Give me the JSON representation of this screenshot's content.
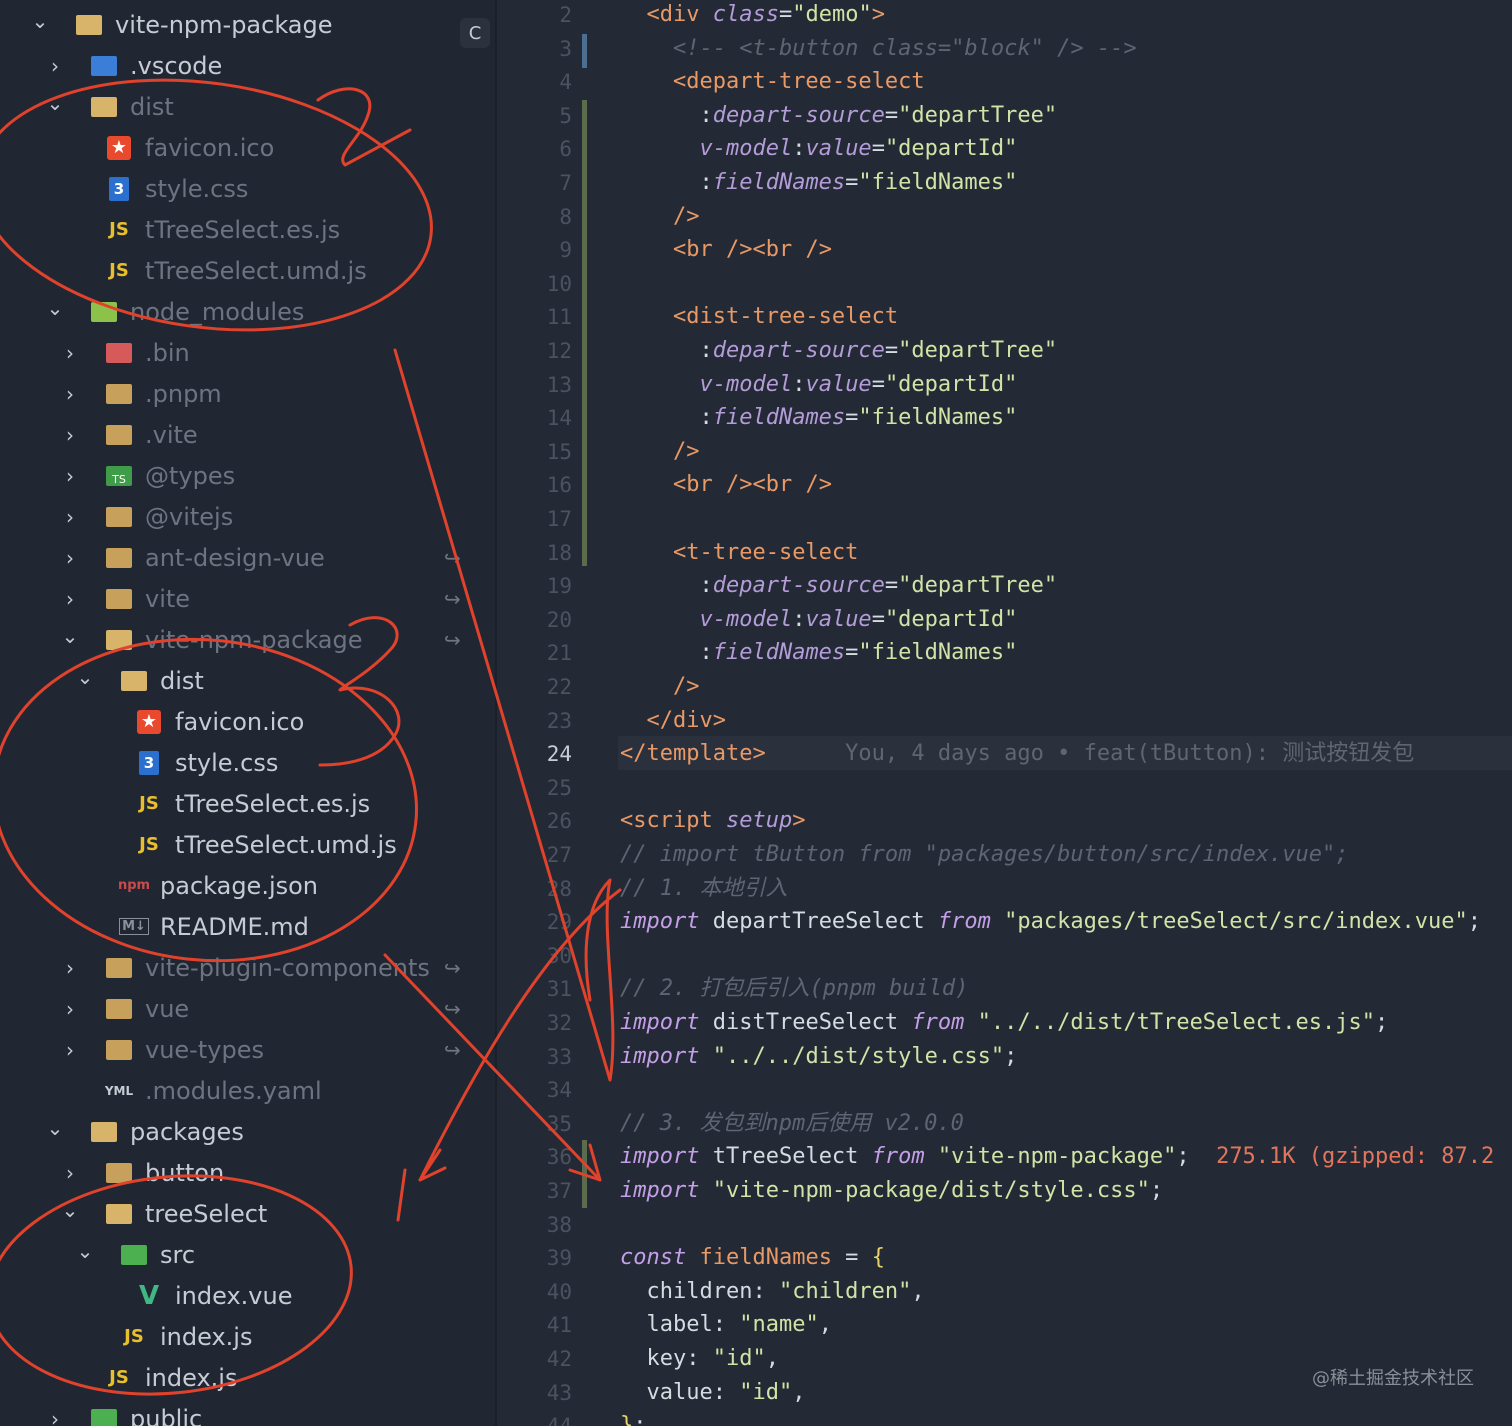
{
  "explorer": {
    "git_status_badge": "C",
    "tree": [
      {
        "label": "vite-npm-package",
        "indent": 0,
        "chevron": "down",
        "icon": "folder-open-icon",
        "style": "bright"
      },
      {
        "label": ".vscode",
        "indent": 1,
        "chevron": "right",
        "icon": "vscode-folder-icon",
        "style": "bright"
      },
      {
        "label": "dist",
        "indent": 1,
        "chevron": "down",
        "icon": "folder-open-icon",
        "style": "dim"
      },
      {
        "label": "favicon.ico",
        "indent": 2,
        "chevron": "",
        "icon": "favicon-icon",
        "style": "dim"
      },
      {
        "label": "style.css",
        "indent": 2,
        "chevron": "",
        "icon": "css-icon",
        "style": "dim"
      },
      {
        "label": "tTreeSelect.es.js",
        "indent": 2,
        "chevron": "",
        "icon": "js-icon",
        "style": "dim"
      },
      {
        "label": "tTreeSelect.umd.js",
        "indent": 2,
        "chevron": "",
        "icon": "js-icon",
        "style": "dim"
      },
      {
        "label": "node_modules",
        "indent": 1,
        "chevron": "down",
        "icon": "node-folder-icon",
        "style": "dim"
      },
      {
        "label": ".bin",
        "indent": 2,
        "chevron": "right",
        "icon": "bin-folder-icon",
        "style": "dim"
      },
      {
        "label": ".pnpm",
        "indent": 2,
        "chevron": "right",
        "icon": "folder-icon",
        "style": "dim"
      },
      {
        "label": ".vite",
        "indent": 2,
        "chevron": "right",
        "icon": "folder-icon",
        "style": "dim"
      },
      {
        "label": "@types",
        "indent": 2,
        "chevron": "right",
        "icon": "ts-folder-icon",
        "style": "dim"
      },
      {
        "label": "@vitejs",
        "indent": 2,
        "chevron": "right",
        "icon": "folder-icon",
        "style": "dim"
      },
      {
        "label": "ant-design-vue",
        "indent": 2,
        "chevron": "right",
        "icon": "folder-icon",
        "style": "dim",
        "git": "↪"
      },
      {
        "label": "vite",
        "indent": 2,
        "chevron": "right",
        "icon": "folder-icon",
        "style": "dim",
        "git": "↪"
      },
      {
        "label": "vite-npm-package",
        "indent": 2,
        "chevron": "down",
        "icon": "folder-open-icon",
        "style": "dim",
        "git": "↪"
      },
      {
        "label": "dist",
        "indent": 3,
        "chevron": "down",
        "icon": "folder-open-icon",
        "style": "bright"
      },
      {
        "label": "favicon.ico",
        "indent": 4,
        "chevron": "",
        "icon": "favicon-icon",
        "style": "bright"
      },
      {
        "label": "style.css",
        "indent": 4,
        "chevron": "",
        "icon": "css-icon",
        "style": "bright"
      },
      {
        "label": "tTreeSelect.es.js",
        "indent": 4,
        "chevron": "",
        "icon": "js-icon",
        "style": "bright"
      },
      {
        "label": "tTreeSelect.umd.js",
        "indent": 4,
        "chevron": "",
        "icon": "js-icon",
        "style": "bright"
      },
      {
        "label": "package.json",
        "indent": 3,
        "chevron": "",
        "icon": "npm-icon",
        "style": "bright"
      },
      {
        "label": "README.md",
        "indent": 3,
        "chevron": "",
        "icon": "markdown-icon",
        "style": "bright"
      },
      {
        "label": "vite-plugin-components",
        "indent": 2,
        "chevron": "right",
        "icon": "folder-icon",
        "style": "dim",
        "git": "↪"
      },
      {
        "label": "vue",
        "indent": 2,
        "chevron": "right",
        "icon": "folder-icon",
        "style": "dim",
        "git": "↪"
      },
      {
        "label": "vue-types",
        "indent": 2,
        "chevron": "right",
        "icon": "folder-icon",
        "style": "dim",
        "git": "↪"
      },
      {
        "label": ".modules.yaml",
        "indent": 2,
        "chevron": "",
        "icon": "yaml-icon",
        "style": "dim"
      },
      {
        "label": "packages",
        "indent": 1,
        "chevron": "down",
        "icon": "folder-open-icon",
        "style": "bright"
      },
      {
        "label": "button",
        "indent": 2,
        "chevron": "right",
        "icon": "folder-icon",
        "style": "bright"
      },
      {
        "label": "treeSelect",
        "indent": 2,
        "chevron": "down",
        "icon": "folder-open-icon",
        "style": "bright"
      },
      {
        "label": "src",
        "indent": 3,
        "chevron": "down",
        "icon": "src-folder-icon",
        "style": "bright"
      },
      {
        "label": "index.vue",
        "indent": 4,
        "chevron": "",
        "icon": "vue-icon",
        "style": "bright"
      },
      {
        "label": "index.js",
        "indent": 3,
        "chevron": "",
        "icon": "js-icon",
        "style": "bright"
      },
      {
        "label": "index.js",
        "indent": 2,
        "chevron": "",
        "icon": "js-icon",
        "style": "bright"
      },
      {
        "label": "public",
        "indent": 1,
        "chevron": "right",
        "icon": "public-folder-icon",
        "style": "bright"
      }
    ]
  },
  "editor": {
    "current_line": 24,
    "lines": [
      {
        "n": 2,
        "tokens": [
          [
            "  ",
            "plain"
          ],
          [
            "<div ",
            "tag"
          ],
          [
            "class",
            "attr"
          ],
          [
            "=",
            "plain"
          ],
          [
            "\"demo\"",
            "str"
          ],
          [
            ">",
            "tag"
          ]
        ]
      },
      {
        "n": 3,
        "tokens": [
          [
            "    <!-- <t-button class=\"block\" /> -->",
            "cmt"
          ]
        ]
      },
      {
        "n": 4,
        "tokens": [
          [
            "    ",
            "plain"
          ],
          [
            "<depart-tree-select",
            "tag"
          ]
        ]
      },
      {
        "n": 5,
        "tokens": [
          [
            "      :",
            "plain"
          ],
          [
            "depart-source",
            "attr"
          ],
          [
            "=",
            "plain"
          ],
          [
            "\"departTree\"",
            "str"
          ]
        ]
      },
      {
        "n": 6,
        "tokens": [
          [
            "      ",
            "plain"
          ],
          [
            "v-model",
            "attr"
          ],
          [
            ":",
            "plain"
          ],
          [
            "value",
            "attr"
          ],
          [
            "=",
            "plain"
          ],
          [
            "\"departId\"",
            "str"
          ]
        ]
      },
      {
        "n": 7,
        "tokens": [
          [
            "      :",
            "plain"
          ],
          [
            "fieldNames",
            "attr"
          ],
          [
            "=",
            "plain"
          ],
          [
            "\"fieldNames\"",
            "str"
          ]
        ]
      },
      {
        "n": 8,
        "tokens": [
          [
            "    ",
            "plain"
          ],
          [
            "/>",
            "tag"
          ]
        ]
      },
      {
        "n": 9,
        "tokens": [
          [
            "    ",
            "plain"
          ],
          [
            "<br />",
            "tag"
          ],
          [
            "<br />",
            "tag"
          ]
        ]
      },
      {
        "n": 10,
        "tokens": []
      },
      {
        "n": 11,
        "tokens": [
          [
            "    ",
            "plain"
          ],
          [
            "<dist-tree-select",
            "tag"
          ]
        ]
      },
      {
        "n": 12,
        "tokens": [
          [
            "      :",
            "plain"
          ],
          [
            "depart-source",
            "attr"
          ],
          [
            "=",
            "plain"
          ],
          [
            "\"departTree\"",
            "str"
          ]
        ]
      },
      {
        "n": 13,
        "tokens": [
          [
            "      ",
            "plain"
          ],
          [
            "v-model",
            "attr"
          ],
          [
            ":",
            "plain"
          ],
          [
            "value",
            "attr"
          ],
          [
            "=",
            "plain"
          ],
          [
            "\"departId\"",
            "str"
          ]
        ]
      },
      {
        "n": 14,
        "tokens": [
          [
            "      :",
            "plain"
          ],
          [
            "fieldNames",
            "attr"
          ],
          [
            "=",
            "plain"
          ],
          [
            "\"fieldNames\"",
            "str"
          ]
        ]
      },
      {
        "n": 15,
        "tokens": [
          [
            "    ",
            "plain"
          ],
          [
            "/>",
            "tag"
          ]
        ]
      },
      {
        "n": 16,
        "tokens": [
          [
            "    ",
            "plain"
          ],
          [
            "<br />",
            "tag"
          ],
          [
            "<br />",
            "tag"
          ]
        ]
      },
      {
        "n": 17,
        "tokens": []
      },
      {
        "n": 18,
        "tokens": [
          [
            "    ",
            "plain"
          ],
          [
            "<t-tree-select",
            "tag"
          ]
        ]
      },
      {
        "n": 19,
        "tokens": [
          [
            "      :",
            "plain"
          ],
          [
            "depart-source",
            "attr"
          ],
          [
            "=",
            "plain"
          ],
          [
            "\"departTree\"",
            "str"
          ]
        ]
      },
      {
        "n": 20,
        "tokens": [
          [
            "      ",
            "plain"
          ],
          [
            "v-model",
            "attr"
          ],
          [
            ":",
            "plain"
          ],
          [
            "value",
            "attr"
          ],
          [
            "=",
            "plain"
          ],
          [
            "\"departId\"",
            "str"
          ]
        ]
      },
      {
        "n": 21,
        "tokens": [
          [
            "      :",
            "plain"
          ],
          [
            "fieldNames",
            "attr"
          ],
          [
            "=",
            "plain"
          ],
          [
            "\"fieldNames\"",
            "str"
          ]
        ]
      },
      {
        "n": 22,
        "tokens": [
          [
            "    ",
            "plain"
          ],
          [
            "/>",
            "tag"
          ]
        ]
      },
      {
        "n": 23,
        "tokens": [
          [
            "  ",
            "plain"
          ],
          [
            "</div>",
            "tag"
          ]
        ]
      },
      {
        "n": 24,
        "tokens": [
          [
            "</template>",
            "tag"
          ],
          [
            "      You, 4 days ago • feat(tButton): 测试按钮发包",
            "blame"
          ]
        ]
      },
      {
        "n": 25,
        "tokens": []
      },
      {
        "n": 26,
        "tokens": [
          [
            "<script ",
            "tag"
          ],
          [
            "setup",
            "attr"
          ],
          [
            ">",
            "tag"
          ]
        ]
      },
      {
        "n": 27,
        "tokens": [
          [
            "// import tButton from \"packages/button/src/index.vue\";",
            "cmt"
          ]
        ]
      },
      {
        "n": 28,
        "tokens": [
          [
            "// 1. 本地引入",
            "cmt"
          ]
        ]
      },
      {
        "n": 29,
        "tokens": [
          [
            "import",
            "kw"
          ],
          [
            " departTreeSelect ",
            "plain"
          ],
          [
            "from",
            "kw"
          ],
          [
            " ",
            "plain"
          ],
          [
            "\"packages/treeSelect/src/index.vue\"",
            "str"
          ],
          [
            ";",
            "plain"
          ]
        ]
      },
      {
        "n": 30,
        "tokens": []
      },
      {
        "n": 31,
        "tokens": [
          [
            "// 2. 打包后引入(pnpm build)",
            "cmt"
          ]
        ]
      },
      {
        "n": 32,
        "tokens": [
          [
            "import",
            "kw"
          ],
          [
            " distTreeSelect ",
            "plain"
          ],
          [
            "from",
            "kw"
          ],
          [
            " ",
            "plain"
          ],
          [
            "\"../../dist/tTreeSelect.es.js\"",
            "str"
          ],
          [
            ";",
            "plain"
          ]
        ]
      },
      {
        "n": 33,
        "tokens": [
          [
            "import",
            "kw"
          ],
          [
            " ",
            "plain"
          ],
          [
            "\"../../dist/style.css\"",
            "str"
          ],
          [
            ";",
            "plain"
          ]
        ]
      },
      {
        "n": 34,
        "tokens": []
      },
      {
        "n": 35,
        "tokens": [
          [
            "// 3. 发包到npm后使用 v2.0.0",
            "cmt"
          ]
        ]
      },
      {
        "n": 36,
        "tokens": [
          [
            "import",
            "kw"
          ],
          [
            " tTreeSelect ",
            "plain"
          ],
          [
            "from",
            "kw"
          ],
          [
            " ",
            "plain"
          ],
          [
            "\"vite-npm-package\"",
            "str"
          ],
          [
            ";",
            "plain"
          ],
          [
            "  275.1K (gzipped: 87.2",
            "size"
          ]
        ]
      },
      {
        "n": 37,
        "tokens": [
          [
            "import",
            "kw"
          ],
          [
            " ",
            "plain"
          ],
          [
            "\"vite-npm-package/dist/style.css\"",
            "str"
          ],
          [
            ";",
            "plain"
          ]
        ]
      },
      {
        "n": 38,
        "tokens": []
      },
      {
        "n": 39,
        "tokens": [
          [
            "const ",
            "kw"
          ],
          [
            "fieldNames",
            "var"
          ],
          [
            " = ",
            "plain"
          ],
          [
            "{",
            "brace"
          ]
        ]
      },
      {
        "n": 40,
        "tokens": [
          [
            "  children: ",
            "plain"
          ],
          [
            "\"children\"",
            "str"
          ],
          [
            ",",
            "plain"
          ]
        ]
      },
      {
        "n": 41,
        "tokens": [
          [
            "  label: ",
            "plain"
          ],
          [
            "\"name\"",
            "str"
          ],
          [
            ",",
            "plain"
          ]
        ]
      },
      {
        "n": 42,
        "tokens": [
          [
            "  key: ",
            "plain"
          ],
          [
            "\"id\"",
            "str"
          ],
          [
            ",",
            "plain"
          ]
        ]
      },
      {
        "n": 43,
        "tokens": [
          [
            "  value: ",
            "plain"
          ],
          [
            "\"id\"",
            "str"
          ],
          [
            ",",
            "plain"
          ]
        ]
      },
      {
        "n": 44,
        "tokens": [
          [
            "}",
            "brace"
          ],
          [
            ";",
            "plain"
          ]
        ]
      }
    ]
  },
  "annotations": {
    "stroke_color": "#e0422c",
    "labels": [
      "2",
      "3"
    ]
  },
  "watermark": "@稀土掘金技术社区"
}
